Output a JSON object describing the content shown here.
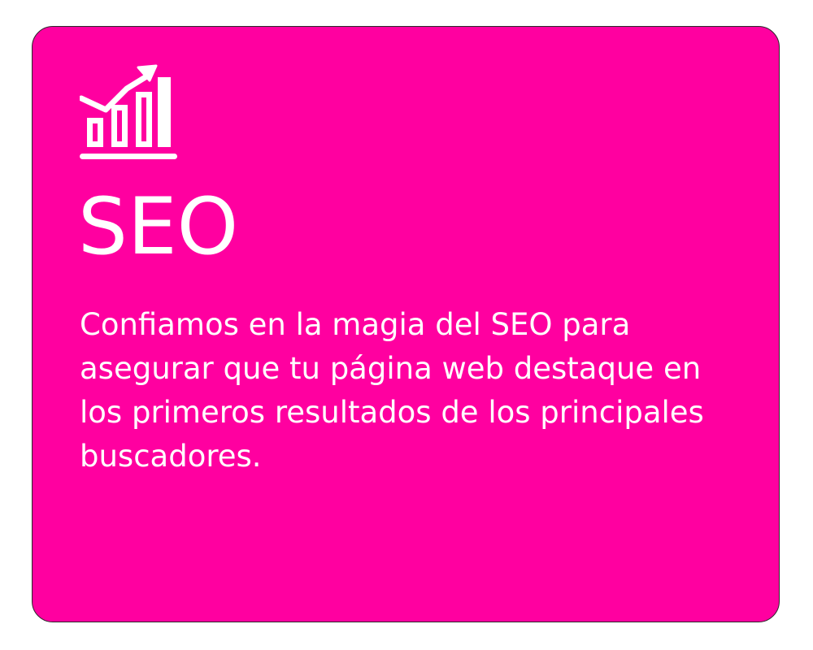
{
  "card": {
    "background_color": "#ff00a0",
    "icon": "bar-chart-trending-up-icon",
    "title": "SEO",
    "description": "Confiamos en la magia del SEO para asegurar que tu página web destaque en los primeros resultados de los principales buscadores."
  }
}
